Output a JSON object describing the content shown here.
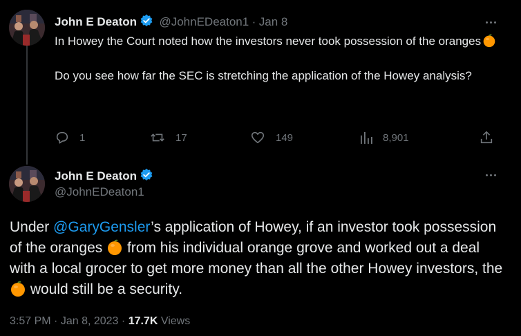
{
  "tweet1": {
    "name": "John E Deaton",
    "handle": "@JohnEDeaton1",
    "separator": "·",
    "date": "Jan 8",
    "text_p1": "In Howey the Court noted how the investors never took possession of the oranges",
    "text_p2": "Do you see how far the SEC is stretching the application of the Howey analysis?",
    "replies": "1",
    "reposts": "17",
    "likes": "149",
    "views": "8,901"
  },
  "tweet2": {
    "name": "John E Deaton",
    "handle": "@JohnEDeaton1",
    "text_a": "Under ",
    "mention": "@GaryGensler",
    "text_b": "’s application of Howey, if an investor took possession of the oranges ",
    "text_c": " from his individual orange grove and worked out a deal with a local grocer to get more money than all the other Howey investors, the ",
    "text_d": " would still be a security.",
    "time": "3:57 PM",
    "dot1": "·",
    "date": "Jan 8, 2023",
    "dot2": "·",
    "views_count": "17.7K",
    "views_label": "Views"
  },
  "icons": {
    "verified": "verified-badge-icon",
    "more": "more-options-icon",
    "reply": "reply-icon",
    "repost": "repost-icon",
    "like": "like-icon",
    "views": "views-icon",
    "share": "share-icon",
    "emoji": "orange-emoji-icon"
  },
  "colors": {
    "background": "#000000",
    "text": "#e7e9ea",
    "secondary": "#71767b",
    "accent": "#1d9bf0",
    "orange": "#ff9700"
  }
}
